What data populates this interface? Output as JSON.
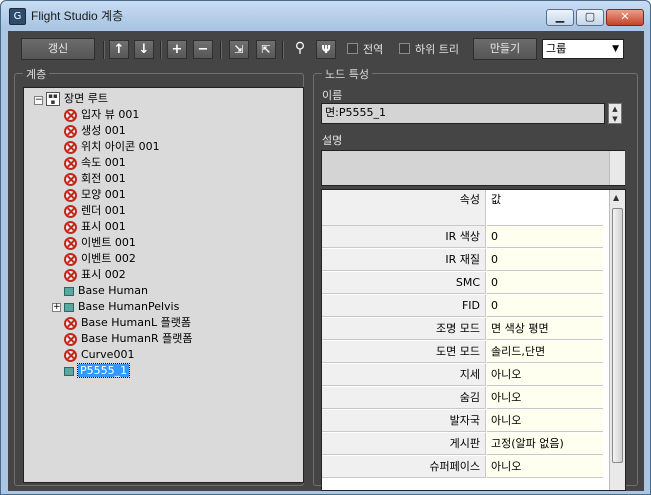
{
  "window": {
    "title": "Flight Studio 계층",
    "minimize_label": "▭",
    "maximize_label": "▢",
    "close_label": "✕"
  },
  "toolbar": {
    "refresh_label": "갱신",
    "move_up_icon": "↑",
    "move_down_icon": "↓",
    "add_icon": "+",
    "remove_icon": "−",
    "global_label": "전역",
    "subtree_label": "하위 트리",
    "create_label": "만들기",
    "group_select_value": "그룹"
  },
  "hierarchy": {
    "group_label": "계층",
    "root": "장면 루트",
    "items": [
      {
        "label": "입자 뷰 001",
        "icon": "error-icon"
      },
      {
        "label": "생성 001",
        "icon": "error-icon"
      },
      {
        "label": "위치 아이콘 001",
        "icon": "error-icon"
      },
      {
        "label": "속도 001",
        "icon": "error-icon"
      },
      {
        "label": "회전 001",
        "icon": "error-icon"
      },
      {
        "label": "모양 001",
        "icon": "error-icon"
      },
      {
        "label": "렌더 001",
        "icon": "error-icon"
      },
      {
        "label": "표시 001",
        "icon": "error-icon"
      },
      {
        "label": "이벤트 001",
        "icon": "error-icon"
      },
      {
        "label": "이벤트 002",
        "icon": "error-icon"
      },
      {
        "label": "표시 002",
        "icon": "error-icon"
      },
      {
        "label": "Base Human",
        "icon": "mesh-icon"
      },
      {
        "label": "Base HumanPelvis",
        "icon": "mesh-icon"
      },
      {
        "label": "Base HumanL 플랫폼",
        "icon": "error-icon"
      },
      {
        "label": "Base HumanR 플랫폼",
        "icon": "error-icon"
      },
      {
        "label": "Curve001",
        "icon": "error-icon"
      },
      {
        "label": "P5555_1",
        "icon": "mesh-icon"
      }
    ]
  },
  "node_props": {
    "group_label": "노드 특성",
    "name_label": "이름",
    "name_value": "면:P5555_1",
    "desc_label": "설명",
    "desc_value": "",
    "header_prop": "속성",
    "header_value": "값",
    "rows": [
      {
        "name": "IR 색상",
        "value": "0"
      },
      {
        "name": "IR 재질",
        "value": "0"
      },
      {
        "name": "SMC",
        "value": "0"
      },
      {
        "name": "FID",
        "value": "0"
      },
      {
        "name": "조명 모드",
        "value": "면 색상 평면"
      },
      {
        "name": "도면 모드",
        "value": "솔리드,단면"
      },
      {
        "name": "지세",
        "value": "아니오"
      },
      {
        "name": "숨김",
        "value": "아니오"
      },
      {
        "name": "발자국",
        "value": "아니오"
      },
      {
        "name": "게시판",
        "value": "고정(알파 없음)"
      },
      {
        "name": "슈퍼페이스",
        "value": "아니오"
      }
    ]
  }
}
